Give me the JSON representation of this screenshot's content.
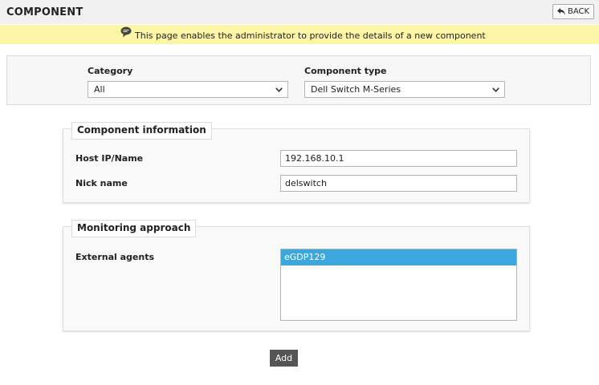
{
  "header": {
    "title": "COMPONENT",
    "back_label": "BACK"
  },
  "info": {
    "message": "This page enables the administrator to provide the details of a new component"
  },
  "filters": {
    "category_label": "Category",
    "category_value": "All",
    "type_label": "Component type",
    "type_value": "Dell Switch M-Series"
  },
  "component_info": {
    "legend": "Component information",
    "host_label": "Host IP/Name",
    "host_value": "192.168.10.1",
    "nick_label": "Nick name",
    "nick_value": "delswitch"
  },
  "monitoring": {
    "legend": "Monitoring approach",
    "agents_label": "External agents",
    "agents": [
      "eGDP129"
    ]
  },
  "actions": {
    "add_label": "Add"
  },
  "colors": {
    "info_bg": "#fdf6a7",
    "selected": "#3ca7dc",
    "add_button": "#555555"
  },
  "icons": {
    "back": "back-arrow-icon",
    "info": "speech-bubble-icon",
    "dropdown": "chevron-down-icon"
  }
}
